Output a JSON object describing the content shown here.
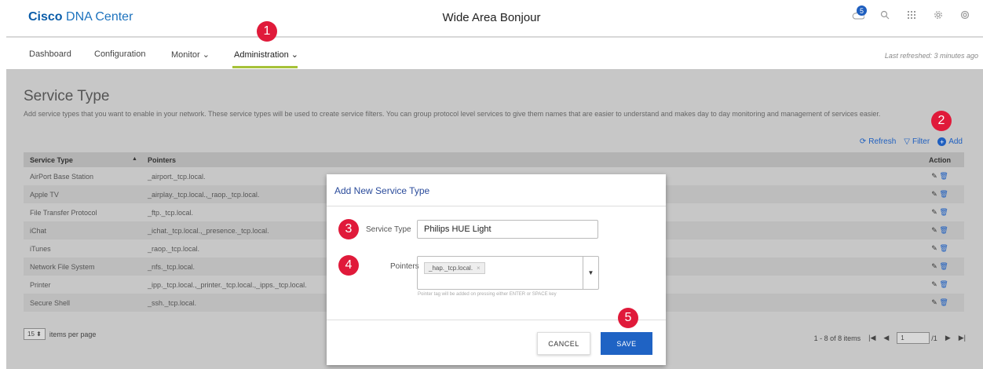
{
  "header": {
    "brand_bold": "Cisco",
    "brand_rest": " DNA Center",
    "title": "Wide Area Bonjour",
    "notifications_count": "5"
  },
  "nav": {
    "items": [
      "Dashboard",
      "Configuration",
      "Monitor ⌄",
      "Administration ⌄"
    ],
    "last_refreshed": "Last refreshed: 3 minutes ago"
  },
  "section": {
    "title": "Service Type",
    "description": "Add service types that you want to enable in your network. These service types will be used to create service filters. You can group protocol level services to give them names that are easier to understand and makes day to day monitoring and management of services easier.",
    "actions": {
      "refresh": "Refresh",
      "filter": "Filter",
      "add": "Add"
    }
  },
  "table": {
    "headers": [
      "Service Type",
      "Pointers",
      "Action"
    ],
    "rows": [
      [
        "AirPort Base Station",
        "_airport._tcp.local."
      ],
      [
        "Apple TV",
        "_airplay._tcp.local.,_raop._tcp.local."
      ],
      [
        "File Transfer Protocol",
        "_ftp._tcp.local."
      ],
      [
        "iChat",
        "_ichat._tcp.local.,_presence._tcp.local."
      ],
      [
        "iTunes",
        "_raop._tcp.local."
      ],
      [
        "Network File System",
        "_nfs._tcp.local."
      ],
      [
        "Printer",
        "_ipp._tcp.local.,_printer._tcp.local.,_ipps._tcp.local."
      ],
      [
        "Secure Shell",
        "_ssh._tcp.local."
      ]
    ]
  },
  "pager": {
    "per_page_value": "15 ⬍",
    "per_page_label": "items per page",
    "range": "1 - 8 of 8 items",
    "page_value": "1",
    "page_total": "/1"
  },
  "modal": {
    "title": "Add New Service Type",
    "service_type_label": "Service Type",
    "service_type_value": "Philips HUE Light",
    "pointers_label": "Pointers",
    "pointer_tag": "_hap._tcp.local.",
    "hint": "Pointer tag will be added on pressing either ENTER or SPACE key",
    "cancel": "CANCEL",
    "save": "SAVE"
  },
  "callouts": [
    "1",
    "2",
    "3",
    "4",
    "5"
  ],
  "colors": {
    "accent": "#1f63c4",
    "callout": "#e01a3a",
    "nav_underline": "#a6c239"
  }
}
